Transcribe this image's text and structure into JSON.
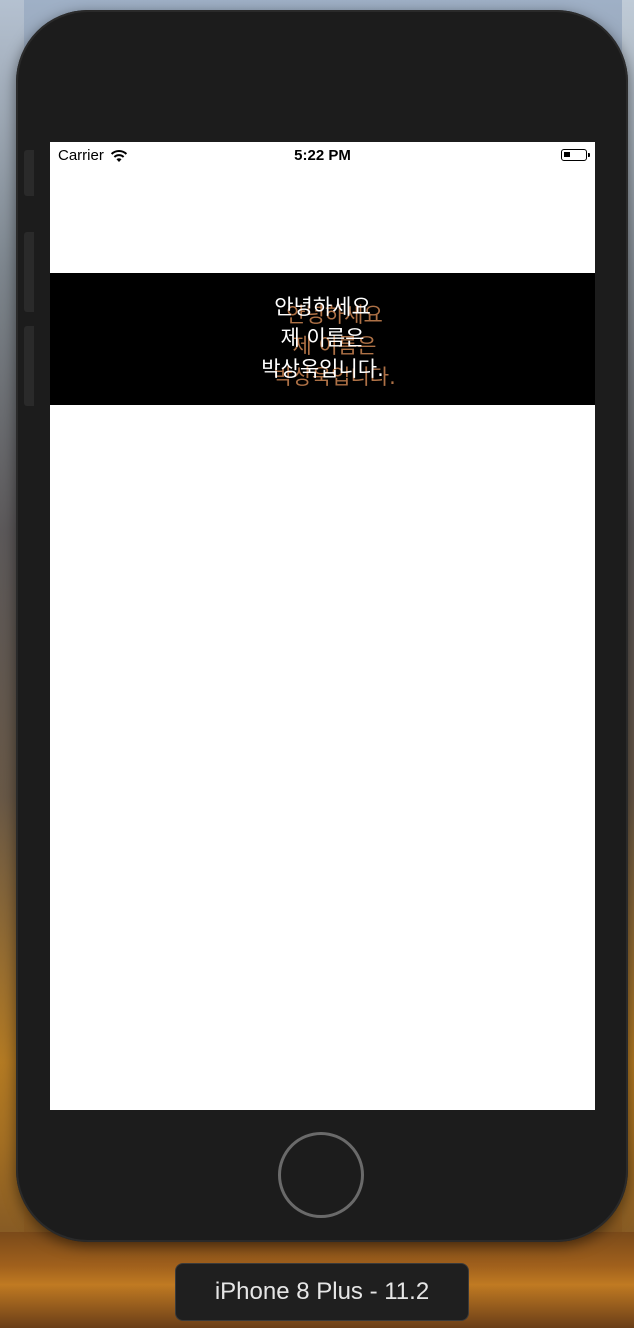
{
  "status_bar": {
    "carrier": "Carrier",
    "wifi_icon": "wifi-icon",
    "time": "5:22 PM",
    "battery_icon": "battery-icon",
    "battery_level": 0.3
  },
  "banner": {
    "lines": [
      "안녕하세요",
      "제 이름은",
      "박상욱입니다."
    ],
    "text_color": "#ffffff",
    "shadow_color": "#b8784a",
    "background": "#000000"
  },
  "device": {
    "label": "iPhone 8 Plus - 11.2",
    "frame_color": "#1c1c1c"
  }
}
